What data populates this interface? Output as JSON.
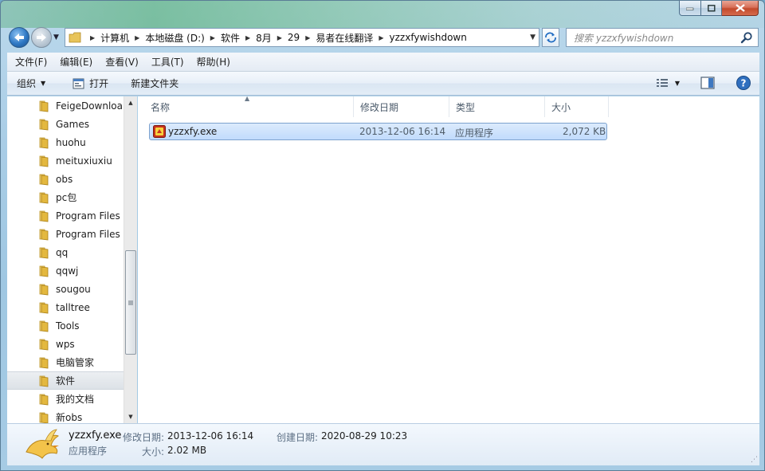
{
  "search": {
    "placeholder": "搜索 yzzxfywishdown"
  },
  "address": {
    "crumbs": [
      "计算机",
      "本地磁盘 (D:)",
      "软件",
      "8月",
      "29",
      "易者在线翻译",
      "yzzxfywishdown"
    ]
  },
  "menu": {
    "items": [
      "文件(F)",
      "编辑(E)",
      "查看(V)",
      "工具(T)",
      "帮助(H)"
    ]
  },
  "toolbar": {
    "organize": "组织",
    "open": "打开",
    "new_folder": "新建文件夹"
  },
  "tree": {
    "items": [
      {
        "label": "FeigeDownloa"
      },
      {
        "label": "Games"
      },
      {
        "label": "huohu"
      },
      {
        "label": "meituxiuxiu"
      },
      {
        "label": "obs"
      },
      {
        "label": "pc包"
      },
      {
        "label": "Program Files"
      },
      {
        "label": "Program Files"
      },
      {
        "label": "qq"
      },
      {
        "label": "qqwj"
      },
      {
        "label": "sougou"
      },
      {
        "label": "talltree"
      },
      {
        "label": "Tools"
      },
      {
        "label": "wps"
      },
      {
        "label": "电脑管家"
      },
      {
        "label": "软件"
      },
      {
        "label": "我的文档"
      },
      {
        "label": "新obs"
      }
    ],
    "selected_index": 15
  },
  "columns": {
    "name": "名称",
    "modified": "修改日期",
    "type": "类型",
    "size": "大小"
  },
  "files": [
    {
      "name": "yzzxfy.exe",
      "modified": "2013-12-06 16:14",
      "type": "应用程序",
      "size": "2,072 KB"
    }
  ],
  "details": {
    "filename": "yzzxfy.exe",
    "modified_label": "修改日期:",
    "modified_value": "2013-12-06 16:14",
    "created_label": "创建日期:",
    "created_value": "2020-08-29 10:23",
    "type_value": "应用程序",
    "size_label": "大小:",
    "size_value": "2.02 MB"
  },
  "colors": {
    "selection": "#c1dbfc",
    "selection_border": "#7da2ce",
    "folder": "#e8c45a"
  }
}
